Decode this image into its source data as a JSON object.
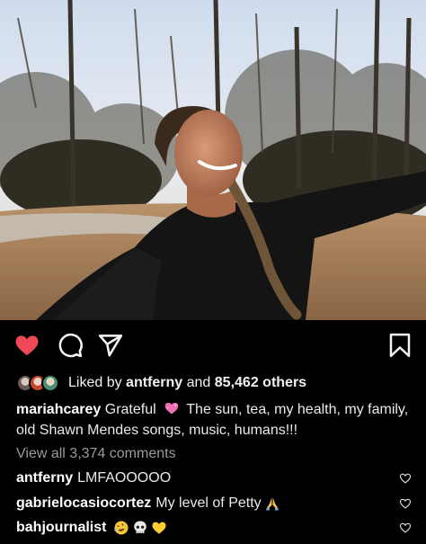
{
  "post": {
    "liked_by_prefix": "Liked by",
    "liked_by_user": "antferny",
    "liked_by_and": "and",
    "liked_by_others": "85,462 others",
    "author": "mariahcarey",
    "caption_lead": "Grateful",
    "caption_rest": "The sun, tea, my health, my family, old Shawn Mendes songs, music, humans!!!",
    "view_all_comments": "View all 3,374 comments"
  },
  "comments": [
    {
      "user": "antferny",
      "text": "LMFAOOOOO"
    },
    {
      "user": "gabrielocasiocortez",
      "text": "My level of Petty"
    },
    {
      "user": "bahjournalist",
      "text": ""
    }
  ],
  "colors": {
    "like_red": "#ed4956",
    "background": "#000000",
    "muted_text": "#9a9a9a"
  },
  "icons": {
    "like": "heart-filled-icon",
    "comment": "comment-bubble-icon",
    "share": "paper-plane-icon",
    "save": "bookmark-icon",
    "comment_like": "heart-outline-icon"
  }
}
